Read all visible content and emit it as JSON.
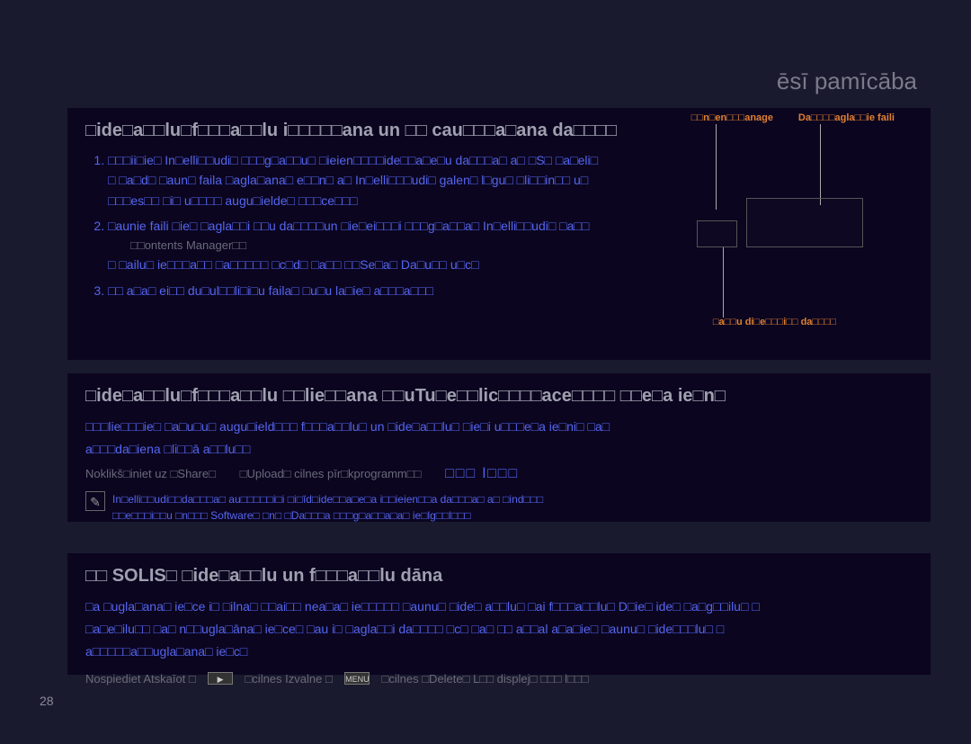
{
  "header": "ēsī pamīcāba",
  "page_number": "28",
  "labels": {
    "l1": "□□n□en□□□anage",
    "l2": "Da□□□□agla□□ie faili",
    "l3": "□a□□u di□e□□□i□□ da□□□□"
  },
  "section1": {
    "title": "□ide□a□□lu□f□□□a□□lu i□□□□□ana un □□ cau□□□a□ana da□□□□",
    "item1": "□□□ii□ie□ In□elli□□udi□ □□□g□a□□u□ □ieien□□□□ide□□a□e□u da□□□a□ a□ □S□ □a□eli□",
    "sub1a": "□ □a□d□ □aun□ faila □agla□ana□ e□□n□ a□ In□elli□□□udi□ galen□ l□gu□ □li□□in□□ u□",
    "sub1b": "□□□es□□ □i□ u□□□□ augu□ielde□ □□□ce□□□",
    "item2": "□aunie faili □ie□ □agla□□i □□u da□□□□un □ie□ei□□□i □□□g□a□□a□ In□elli□□udi□ □a□□",
    "sub2a": "□□ontents Manager□□",
    "sub2b": "□  □ailu□ ie□□□a□□ □a□□□□□ □c□d□ □a□□ □□Se□a□ Da□u□□ u□c□",
    "item3": "□□ a□a□ ei□□ du□ul□□li□i□u faila□ □u□u la□ie□ a□□□a□□□"
  },
  "section2": {
    "title": "□ide□a□□lu□f□□□a□□lu □□lie□□ana □□uTu□e□□lic□□□□ace□□□□ □□e□a ie□n□",
    "body1": "□□□lie□□□ie□ □a□u□u□ augu□ield□□□ f□□□a□□lu□ un □ide□a□□lu□ □ie□i u□□□e□a ie□ni□ □a□",
    "body2": "a□□□da□iena □li□□ā a□□lu□□",
    "link1": "Noklikš□iniet uz □Share□",
    "link2": "□Upload□ cilnes pīr□kprogramm□□",
    "link3": "□□□ l□□□",
    "note1": "In□elli□□udi□□da□□□a□ au□□□□□i□i □i□īd□ide□□a□e□a i□□ieien□□a da□□□a□ a□ □ind□□□",
    "note2": "□□e□□□i□□u □n□□□ Software□ □n□ □Da□□□a □□□g□a□□a□a□ ie□lg□□l□□□"
  },
  "section3": {
    "title": "□□ SOLIS□ □ide□a□□lu un f□□□a□□lu dāna",
    "body1": "□a □ugla□ana□ ie□ce i□ □ilna□ □□ai□□ nea□a□ ie□□□□□ □aunu□ □ide□ a□□lu□ □ai f□□□a□□lu□ D□ie□ ide□ □a□g□□ilu□ □",
    "body2": "□a□e□ilu□□ □a□ n□□ugla□āna□ ie□ce□ □au i□ □agla□□i da□□□□ □c□ □a□ □□ a□□al a□a□ie□ □aunu□ □ide□□□lu□ □",
    "body3": "a□□□□□a□□ugla□ana□ ie□c□",
    "action1": "Nospiediet Atskaīot □",
    "icon1": "▶",
    "action2": "□cilnes   Izvalne □",
    "icon2": "MENU",
    "action3": "□cilnes   □Delete□ L□□ displej□ □□□ l□□□"
  }
}
